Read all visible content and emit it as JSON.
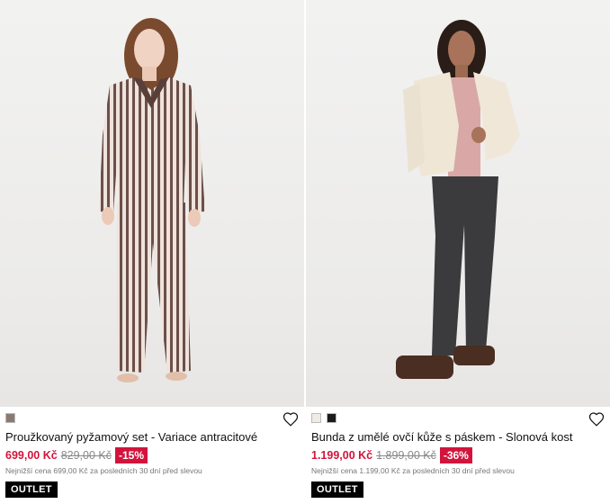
{
  "products": [
    {
      "title": "Proužkovaný pyžamový set - Variace antracitové",
      "price_now": "699,00 Kč",
      "price_old": "829,00 Kč",
      "discount": "-15%",
      "note": "Nejnižší cena 699,00 Kč za posledních 30 dní před slevou",
      "tag": "OUTLET",
      "swatch_colors": [
        "#8a7a72"
      ],
      "wishlist_icon": "heart-outline-icon"
    },
    {
      "title": "Bunda z umělé ovčí kůže s páskem - Slonová kost",
      "price_now": "1.199,00 Kč",
      "price_old": "1.899,00 Kč",
      "discount": "-36%",
      "note": "Nejnižší cena 1.199,00 Kč za posledních 30 dní před slevou",
      "tag": "OUTLET",
      "swatch_colors": [
        "#efece4",
        "#1b1b1b"
      ],
      "wishlist_icon": "heart-outline-icon"
    }
  ],
  "colors": {
    "sale_red": "#d2143c",
    "outlet_black": "#000000"
  }
}
